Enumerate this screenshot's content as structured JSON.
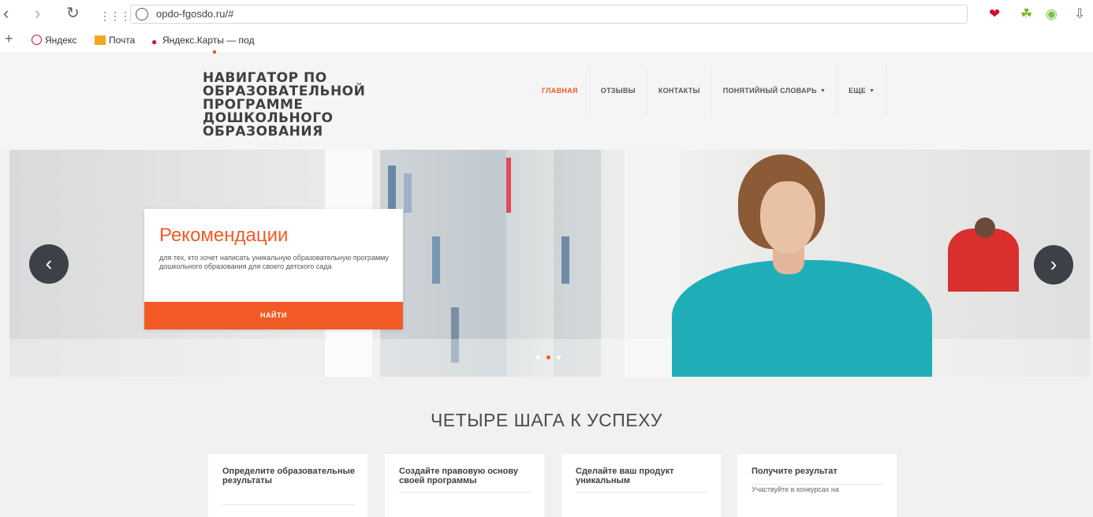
{
  "browser": {
    "url": "opdo-fgosdo.ru/#",
    "bookmarks": [
      {
        "label": "Яндекс",
        "icon": "yandex-icon"
      },
      {
        "label": "Почта",
        "icon": "mail-icon"
      },
      {
        "label": "Яндекс.Карты — под",
        "icon": "map-pin-icon"
      }
    ]
  },
  "site": {
    "logo_lines": [
      "НАВИГАТОР ПО",
      "ОБРАЗОВАТЕЛЬНОЙ",
      "ПРОГРАММЕ",
      "ДОШКОЛЬНОГО",
      "ОБРАЗОВАНИЯ"
    ],
    "menu": [
      {
        "label": "ГЛАВНАЯ",
        "active": true
      },
      {
        "label": "ОТЗЫВЫ"
      },
      {
        "label": "КОНТАКТЫ"
      },
      {
        "label": "ПОНЯТИЙНЫЙ СЛОВАРЬ",
        "dropdown": true
      },
      {
        "label": "ЕЩЕ",
        "dropdown": true
      }
    ],
    "accent_color": "#f15a24"
  },
  "hero": {
    "title": "Рекомендации",
    "description": "для тех, кто хочет написать уникальную образовательную программу дошкольного образования для своего детского сада",
    "button": "НАЙТИ",
    "slides": 3,
    "active_slide": 2
  },
  "steps": {
    "title": "ЧЕТЫРЕ ШАГА К УСПЕХУ",
    "items": [
      {
        "title": "Определите образовательные результаты",
        "text": ""
      },
      {
        "title": "Создайте правовую основу своей программы",
        "text": ""
      },
      {
        "title": "Сделайте ваш продукт уникальным",
        "text": ""
      },
      {
        "title": "Получите результат",
        "text": "Участвуйте в конкурсах на"
      }
    ]
  }
}
